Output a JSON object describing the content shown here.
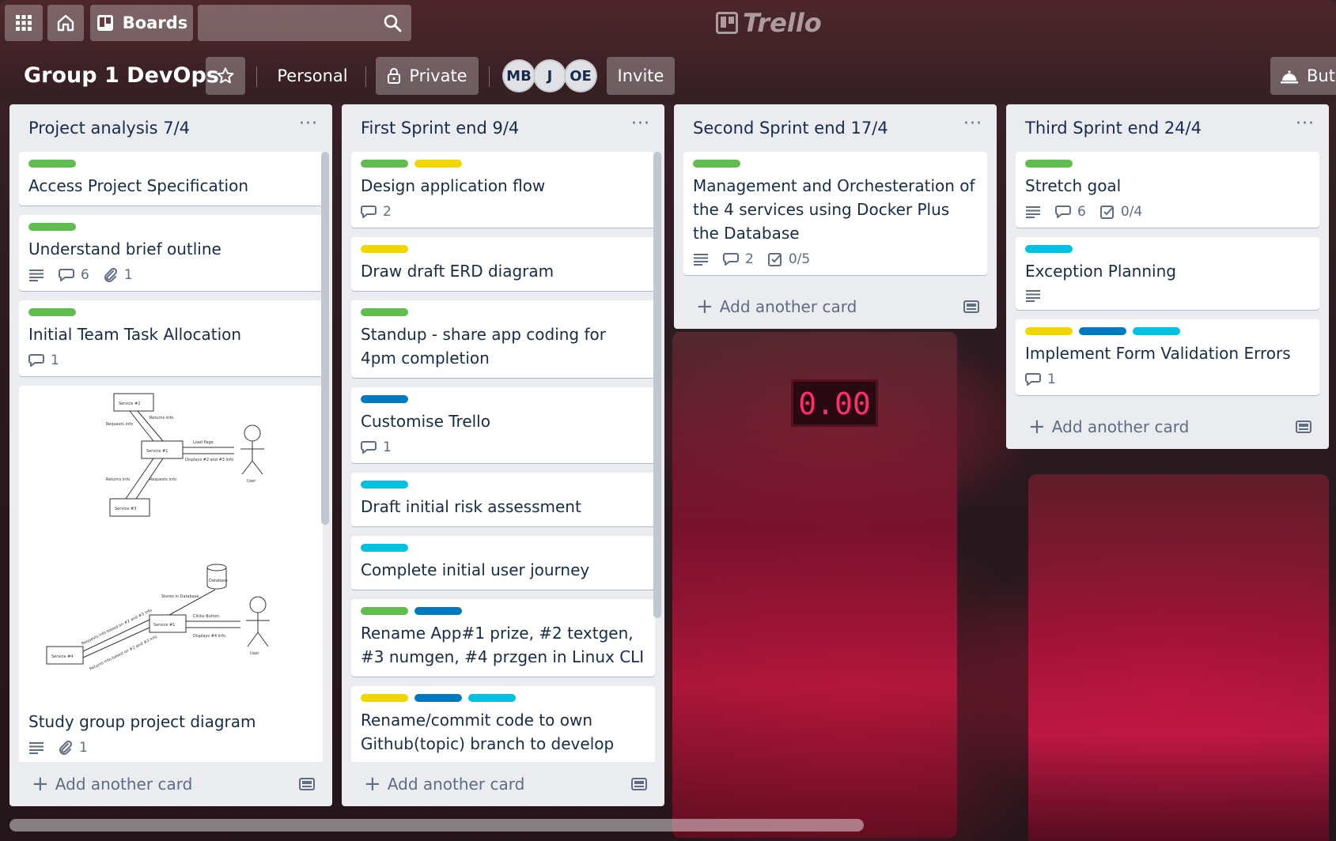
{
  "topbar": {
    "boards_label": "Boards",
    "search_placeholder": "",
    "logo_text": "Trello"
  },
  "board": {
    "title": "Group 1 DevOps",
    "workspace_label": "Personal",
    "visibility_label": "Private",
    "members": [
      "MB",
      "J",
      "OE"
    ],
    "invite_label": "Invite",
    "butler_label": "Butl"
  },
  "lists": [
    {
      "title": "Project analysis 7/4",
      "add_label": "Add another card",
      "cards": [
        {
          "labels": [
            "#61bd4f"
          ],
          "title": "Access Project Specification",
          "badges": {}
        },
        {
          "labels": [
            "#61bd4f"
          ],
          "title": "Understand brief outline",
          "badges": {
            "description": true,
            "comments": "6",
            "attachments": "1"
          }
        },
        {
          "labels": [
            "#61bd4f"
          ],
          "title": "Initial Team Task Allocation",
          "badges": {
            "comments": "1"
          }
        },
        {
          "labels": [],
          "title": "Study group project diagram",
          "badges": {
            "description": true,
            "attachments": "1"
          },
          "cover": "diagram"
        }
      ]
    },
    {
      "title": "First Sprint end 9/4",
      "add_label": "Add another card",
      "cards": [
        {
          "labels": [
            "#61bd4f",
            "#f2d600"
          ],
          "title": "Design application flow",
          "badges": {
            "comments": "2"
          }
        },
        {
          "labels": [
            "#f2d600"
          ],
          "title": "Draw draft ERD diagram",
          "badges": {}
        },
        {
          "labels": [
            "#61bd4f"
          ],
          "title": "Standup - share app coding for 4pm completion",
          "badges": {}
        },
        {
          "labels": [
            "#0079bf"
          ],
          "title": "Customise Trello",
          "badges": {
            "comments": "1"
          }
        },
        {
          "labels": [
            "#00c2e0"
          ],
          "title": "Draft initial risk assessment",
          "badges": {}
        },
        {
          "labels": [
            "#00c2e0"
          ],
          "title": "Complete initial user journey",
          "badges": {}
        },
        {
          "labels": [
            "#61bd4f",
            "#0079bf"
          ],
          "title": "Rename App#1 prize, #2 textgen, #3 numgen, #4 przgen in Linux CLI",
          "badges": {}
        },
        {
          "labels": [
            "#f2d600",
            "#0079bf",
            "#00c2e0"
          ],
          "title": "Rename/commit code to own Github(topic) branch to develop",
          "badges": {}
        }
      ]
    },
    {
      "title": "Second Sprint end 17/4",
      "add_label": "Add another card",
      "cards": [
        {
          "labels": [
            "#61bd4f"
          ],
          "title": "Management and Orchesteration of the 4 services using Docker Plus the Database",
          "badges": {
            "description": true,
            "comments": "2",
            "checklist": "0/5"
          }
        }
      ]
    },
    {
      "title": "Third Sprint end 24/4",
      "add_label": "Add another card",
      "cards": [
        {
          "labels": [
            "#61bd4f"
          ],
          "title": "Stretch goal",
          "badges": {
            "description": true,
            "comments": "6",
            "checklist": "0/4"
          }
        },
        {
          "labels": [
            "#00c2e0"
          ],
          "title": "Exception Planning",
          "badges": {
            "description": true
          }
        },
        {
          "labels": [
            "#f2d600",
            "#0079bf",
            "#00c2e0"
          ],
          "title": "Implement Form Validation Errors",
          "badges": {
            "comments": "1"
          }
        }
      ]
    }
  ],
  "diagram_texts": {
    "service2": "Service #2",
    "service1": "Service #1",
    "service3": "Service #3",
    "service4": "Service #4",
    "user": "User",
    "database": "Database",
    "load_page": "Load Page",
    "requests_info": "Requests info",
    "returns_info": "Returns info",
    "displays": "Displays #2 and #3 info",
    "stores": "Stores in Database",
    "clicks": "Clicks Button",
    "displays4": "Displays #4 Info",
    "req_based": "Requests info based on #2 and #3 info",
    "ret_based": "Returns info based on #2 and #3 info"
  }
}
